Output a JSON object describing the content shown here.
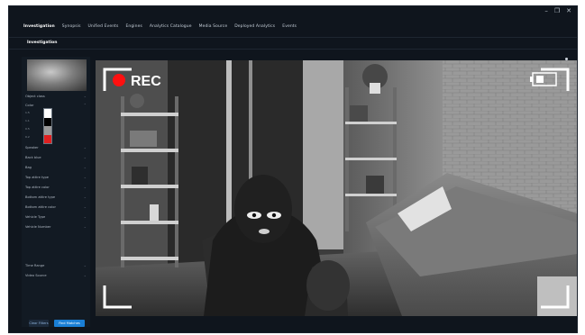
{
  "window_controls": {
    "minimize": "–",
    "restore": "❐",
    "close": "✕"
  },
  "tabs": [
    "Investigation",
    "Synopsis",
    "Unified Events",
    "Engines",
    "Analytics Catalogue",
    "Media Source",
    "Deployed Analytics",
    "Events"
  ],
  "subtab": "Investigation",
  "filters": {
    "items": [
      "Object class",
      "Color",
      "Speaker",
      "Back blue",
      "Bag",
      "Top attire type",
      "Top attire color",
      "Bottom attire type",
      "Bottom attire color",
      "Vehicle Type",
      "Vehicle Number",
      "Time Range",
      "Video Source"
    ],
    "color_swatch_labels": [
      "1.5",
      "1.1",
      "0.5",
      "0.2"
    ]
  },
  "buttons": {
    "clear": "Clear Filters",
    "find": "Find Matches"
  },
  "camera": {
    "rec_label": "REC",
    "rec_color": "#ff1010",
    "frame_color": "#ffffff"
  }
}
